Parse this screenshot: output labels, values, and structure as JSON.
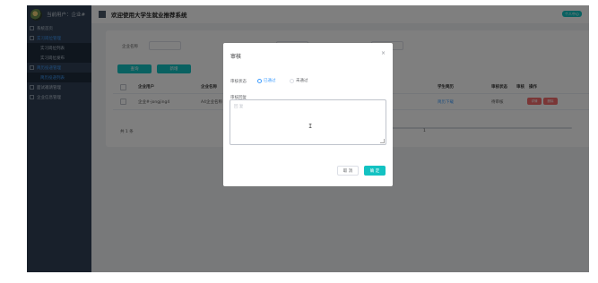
{
  "sidebar": {
    "user_label": "当前用户：企业#",
    "items": [
      {
        "label": "系统首页"
      },
      {
        "label": "实习岗位管理"
      },
      {
        "label": "实习岗位列表"
      },
      {
        "label": "实习岗位发布"
      },
      {
        "label": "简历投递管理"
      },
      {
        "label": "简历投递列表"
      },
      {
        "label": "面试邀请管理"
      },
      {
        "label": "企业信息管理"
      }
    ]
  },
  "header": {
    "title": "欢迎使用大学生就业推荐系统",
    "personal_center": "个人中心"
  },
  "filters": {
    "company_label": "企业名称",
    "student_label": "学生姓名",
    "status_label": "审核状态"
  },
  "toolbar": {
    "search_label": "查询",
    "add_label": "新增"
  },
  "table": {
    "columns": [
      "企业用户",
      "企业名称",
      "学生简历",
      "审核状态",
      "审核",
      "操作"
    ],
    "rows": [
      {
        "company_user": "企业#-jongjing4",
        "company_name": "A4企业名称",
        "resume": "简历下载",
        "status": "待审核"
      }
    ],
    "row_actions": [
      "详情",
      "删除"
    ]
  },
  "pagination": {
    "total": "共 1 条",
    "page": "1"
  },
  "dialog": {
    "title": "审核",
    "close_symbol": "×",
    "status_label": "审核状态",
    "options": [
      {
        "label": "已通过",
        "checked": true
      },
      {
        "label": "未通过",
        "checked": false
      }
    ],
    "reply_label": "审核回复",
    "reply_placeholder": "回 复",
    "cancel_label": "取 消",
    "confirm_label": "确 定"
  },
  "colors": {
    "sidebar": "#304156",
    "accent": "#13c2c2",
    "radio": "#409eff",
    "danger": "#f56c6c"
  }
}
